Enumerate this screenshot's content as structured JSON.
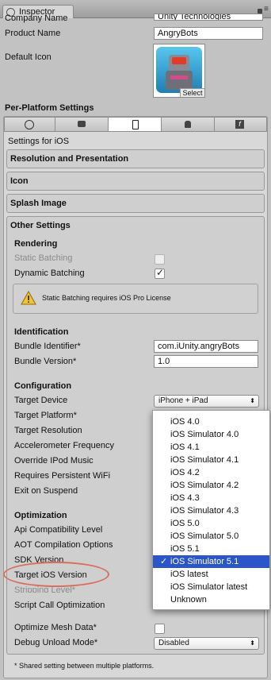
{
  "tab": {
    "title": "Inspector"
  },
  "company": {
    "label": "Company Name",
    "value": "Unity Technologies"
  },
  "product": {
    "label": "Product Name",
    "value": "AngryBots"
  },
  "default_icon": {
    "label": "Default Icon",
    "select_label": "Select"
  },
  "per_platform": {
    "title": "Per-Platform Settings",
    "settings_for": "Settings for iOS"
  },
  "platform_tabs": [
    "globe-icon",
    "gamepad-icon",
    "iphone-icon",
    "android-icon",
    "flash-icon"
  ],
  "sections": {
    "resolution": "Resolution and Presentation",
    "icon": "Icon",
    "splash": "Splash Image",
    "other": "Other Settings"
  },
  "rendering": {
    "title": "Rendering",
    "static_batching": {
      "label": "Static Batching",
      "checked": false
    },
    "dynamic_batching": {
      "label": "Dynamic Batching",
      "checked": true
    },
    "warning": "Static Batching requires iOS Pro License"
  },
  "identification": {
    "title": "Identification",
    "bundle_identifier": {
      "label": "Bundle Identifier*",
      "value": "com.iUnity.angryBots"
    },
    "bundle_version": {
      "label": "Bundle Version*",
      "value": "1.0"
    }
  },
  "configuration": {
    "title": "Configuration",
    "target_device": {
      "label": "Target Device",
      "value": "iPhone + iPad"
    },
    "target_platform": {
      "label": "Target Platform*"
    },
    "target_resolution": {
      "label": "Target Resolution"
    },
    "accelerometer": {
      "label": "Accelerometer Frequency"
    },
    "override_ipod": {
      "label": "Override IPod Music"
    },
    "requires_wifi": {
      "label": "Requires Persistent WiFi"
    },
    "exit_on_suspend": {
      "label": "Exit on Suspend"
    }
  },
  "optimization": {
    "title": "Optimization",
    "api_compat": {
      "label": "Api Compatibility Level"
    },
    "aot": {
      "label": "AOT Compilation Options"
    },
    "sdk_version": {
      "label": "SDK Version"
    },
    "target_ios": {
      "label": "Target iOS Version"
    },
    "stripping": {
      "label": "Stripping Level*"
    },
    "script_call": {
      "label": "Script Call Optimization"
    },
    "optimize_mesh": {
      "label": "Optimize Mesh Data*",
      "checked": false
    },
    "debug_unload": {
      "label": "Debug Unload Mode*",
      "value": "Disabled"
    }
  },
  "footnote": "* Shared setting between multiple platforms.",
  "dropdown": {
    "options": [
      "iOS 4.0",
      "iOS Simulator 4.0",
      "iOS 4.1",
      "iOS Simulator 4.1",
      "iOS 4.2",
      "iOS Simulator 4.2",
      "iOS 4.3",
      "iOS Simulator 4.3",
      "iOS 5.0",
      "iOS Simulator 5.0",
      "iOS 5.1",
      "iOS Simulator 5.1",
      "iOS latest",
      "iOS Simulator latest",
      "Unknown"
    ],
    "selected_index": 11,
    "check": "✓"
  },
  "colors": {
    "selection": "#2b56c9",
    "highlight_ring": "#d9705f",
    "warning": "#f2c230"
  }
}
